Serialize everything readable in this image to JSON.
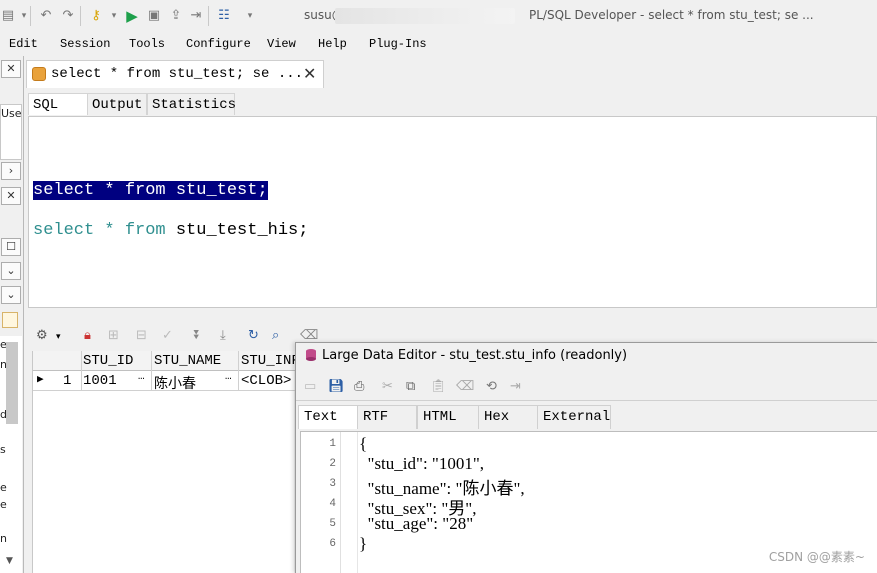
{
  "titlebar": {
    "user": "susu@",
    "title": "PL/SQL Developer - select * from stu_test; se ..."
  },
  "menu": [
    "Edit",
    "Session",
    "Tools",
    "Configure",
    "View",
    "Help",
    "Plug-Ins"
  ],
  "left_panel": {
    "frag_use": "Use",
    "frag_e1": "e",
    "frag_n": "n",
    "frag_d": "d",
    "frag_s": "s",
    "frag_e2": "e",
    "frag_e3": "e",
    "frag_n2": "n"
  },
  "doc_tab": {
    "label": "select * from stu_test; se ...",
    "close": "✕"
  },
  "sub_tabs": [
    "SQL",
    "Output",
    "Statistics"
  ],
  "editor": {
    "line1": {
      "kw1": "select",
      "op": " * ",
      "kw2": "from",
      "rest": " stu_test;"
    },
    "line2": {
      "kw1": "select",
      "op": " * ",
      "kw2": "from",
      "rest": " stu_test_his;"
    }
  },
  "grid": {
    "columns": [
      "STU_ID",
      "STU_NAME",
      "STU_INF"
    ],
    "rows": [
      {
        "num": "1",
        "stu_id": "1001",
        "stu_name": "陈小春",
        "stu_info": "<CLOB>"
      }
    ],
    "ellipsis": "…"
  },
  "large_data_editor": {
    "title": "Large Data Editor - stu_test.stu_info (readonly)",
    "tabs": [
      "Text",
      "RTF",
      "HTML",
      "Hex",
      "External"
    ],
    "line_numbers": [
      "1",
      "2",
      "3",
      "4",
      "5",
      "6"
    ],
    "lines": [
      "{",
      "  \"stu_id\": \"1001\",",
      "  \"stu_name\": \"陈小春\",",
      "  \"stu_sex\": \"男\",",
      "  \"stu_age\": \"28\"",
      "}"
    ]
  },
  "watermark": "CSDN @@素素~",
  "colors": {
    "selection": "#000080",
    "keyword": "#2f8f8f",
    "run": "#1ea04b"
  }
}
